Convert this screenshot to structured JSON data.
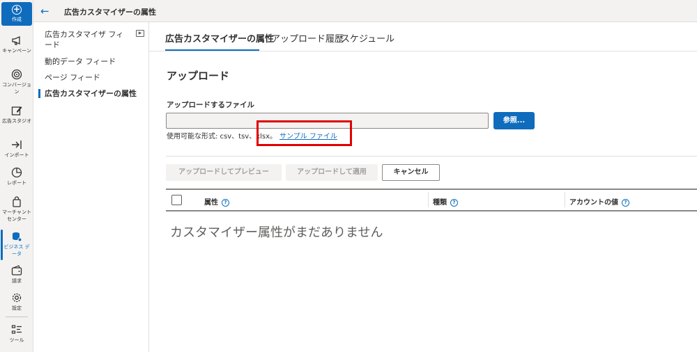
{
  "rail": {
    "create_label": "作成",
    "items": [
      {
        "label": "キャンペーン",
        "icon": "megaphone-icon"
      },
      {
        "label": "コンバージョン",
        "icon": "target-icon"
      },
      {
        "label": "広告スタジオ",
        "icon": "edit-image-icon"
      },
      {
        "label": "インポート",
        "icon": "import-arrow-icon"
      },
      {
        "label": "レポート",
        "icon": "pie-chart-icon"
      },
      {
        "label": "マーチャント センター",
        "icon": "shopping-bag-icon"
      },
      {
        "label": "ビジネス データ",
        "icon": "database-icon"
      },
      {
        "label": "請求",
        "icon": "wallet-icon"
      },
      {
        "label": "設定",
        "icon": "gear-icon"
      },
      {
        "label": "ツール",
        "icon": "tools-list-icon"
      }
    ],
    "active_index": 6,
    "accent_color": "#0f6cbd"
  },
  "topbar": {
    "title": "広告カスタマイザーの属性"
  },
  "subnav": {
    "items": [
      {
        "label": "広告カスタマイザ フィード"
      },
      {
        "label": "動的データ フィード"
      },
      {
        "label": "ページ フィード"
      },
      {
        "label": "広告カスタマイザーの属性"
      }
    ]
  },
  "tabs": [
    {
      "label": "広告カスタマイザーの属性"
    },
    {
      "label": "アップロード履歴"
    },
    {
      "label": "スケジュール"
    }
  ],
  "upload": {
    "section_title": "アップロード",
    "field_label": "アップロードするファイル",
    "file_value": "",
    "browse_label": "参照...",
    "formats_text": "使用可能な形式: csv、tsv、xlsx。",
    "sample_link": "サンプル ファイル"
  },
  "actions": {
    "preview_label": "アップロードしてプレビュー",
    "apply_label": "アップロードして適用",
    "cancel_label": "キャンセル"
  },
  "table": {
    "columns": [
      {
        "label": "属性"
      },
      {
        "label": "種類"
      },
      {
        "label": "アカウントの値"
      }
    ],
    "empty_message": "カスタマイザー属性がまだありません"
  }
}
